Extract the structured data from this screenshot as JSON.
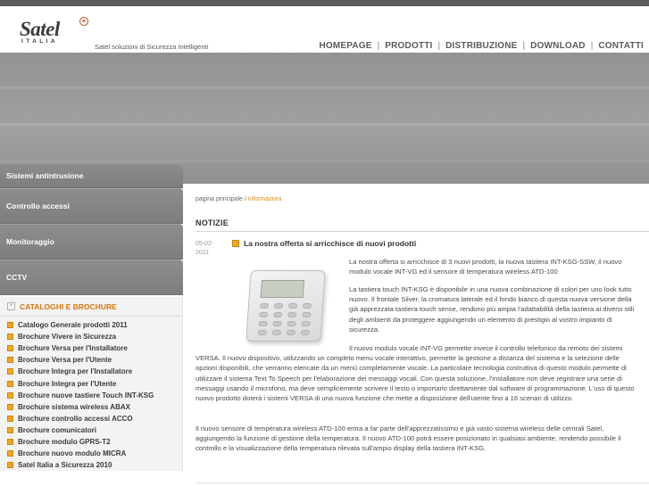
{
  "brand": {
    "logo": "Satel",
    "logo_sub": "ITALIA",
    "tagline": "Satel soluzioni di Sicurezza Intelligenti"
  },
  "nav": [
    "HOMEPAGE",
    "PRODOTTI",
    "DISTRIBUZIONE",
    "DOWNLOAD",
    "CONTATTI"
  ],
  "sidebar": {
    "sections": [
      "Sistemi antintrusione",
      "Controllo accessi",
      "Monitoraggio",
      "CCTV"
    ],
    "catalog_title": "CATALOGHI E BROCHURE",
    "catalog_items": [
      "Catalogo Generale prodotti 2011",
      "Brochure Vivere in Sicurezza",
      "Brochure Versa per l'Installatore",
      "Brochure Versa per l'Utente",
      "Brochure Integra per l'Installatore",
      "Brochure Integra per l'Utente",
      "Brochure nuove tastiere Touch INT-KSG",
      "Brochure sistema wireless ABAX",
      "Brochure controllo accessi ACCO",
      "Brochure comunicatori",
      "Brochure modulo GPRS-T2",
      "Brochure nuovo modulo MICRA",
      "Satel Italia a Sicurezza 2010"
    ]
  },
  "breadcrumb": {
    "home": "pagina principale",
    "sep": "/",
    "current": "informazioni"
  },
  "section_title": "NOTIZIE",
  "news": {
    "date": "05-02-2011",
    "title": "La nostra offerta si arricchisce di nuovi prodotti",
    "paragraphs": [
      "La nostra offerta si arricchisce di 3 nuovi prodotti, la nuova tastiera INT-KSG-SSW, il nuovo modulo vocale INT-VG ed il sensore di temperatura wireless ATD-100",
      "La tastiera touch INT-KSG è disponibile in una nuova combinazione di colori per uno look tutto nuovo. Il frontale Silver, la cromatura laterale ed il fondo bianco di questa nuova versione della già apprezzata tastiera touch sense, rendono più ampia l'adattabilità della tastiera ai diversi stili degli ambienti da proteggere aggiungendo un elemento di prestigio al vostro impianto di sicurezza.",
      "Il nuovo modulo vocale INT-VG permette invece il controllo telefonico da remoto dei sistemi VERSA. Il nuovo dispositivo, utilizzando un completo menu vocale interattivo, permette la gestione a distanza del sistema e la selezione delle opzioni disponibili, che verranno elencate da un menù completamente vocale. La particolare tecnologia costruttiva di questo modulo permette di utilizzare il sistema Text To Speech per l'elaborazione dei messaggi vocali. Con questa soluzione, l'installatore non deve registrare una serie di messaggi usando il microfono, ma deve semplicemente scrivere il testo o importarlo direttamente dal software di programmazione. L'uso di questo nuovo prodotto doterà i sistemi VERSA di una nuova funzione che mette a disposizione dell'utente fino a 16 scenari di utilizzo.",
      "Il nuovo sensore di temperatura wireless ATD-100 entra a far parte dell'apprezzatissimo e già vasto sistema wireless delle centrali Satel, aggiungendo la funzione di gestione della temperatura. Il nuovo ATD-100 potrà essere posizionato in qualsiasi ambiente, rendendo possibile il controllo e la visualizzazione della temperatura rilevata sull'ampio display della tastiera INT-KSG."
    ]
  },
  "colors": {
    "accent": "#e08a14",
    "bullet": "#f3a81b",
    "sidebar": "#858585",
    "banner": "#9c9c9c"
  }
}
